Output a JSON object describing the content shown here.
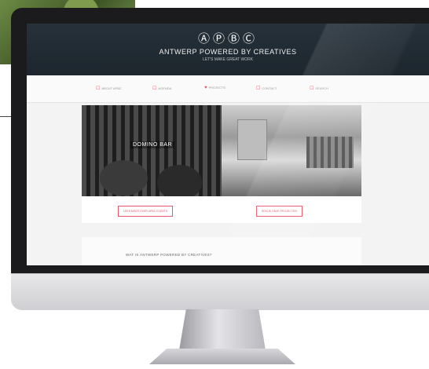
{
  "site": {
    "logo": "ⒶⓅⒷⒸ",
    "title": "ANTWERP POWERED BY CREATIVES",
    "tagline": "LET'S MAKE GREAT WORK"
  },
  "nav": [
    {
      "label": "ABOUT APBC",
      "icon": "☐"
    },
    {
      "label": "AGENDA",
      "icon": "☐"
    },
    {
      "label": "PROJECTS",
      "icon": "♥"
    },
    {
      "label": "CONTACT",
      "icon": "☐"
    },
    {
      "label": "SEARCH",
      "icon": "☐"
    }
  ],
  "hero": {
    "caption": "DOMINO BAR",
    "left_button": "LEES MEER OVER APBC EVENTS",
    "right_button": "BEKIJK ONZE PROJECTEN"
  },
  "card": {
    "text": "WAT IS ANTWERP POWERED BY CREATIVES?"
  },
  "colors": {
    "accent": "#e8566b",
    "header_bg": "#222c34"
  }
}
